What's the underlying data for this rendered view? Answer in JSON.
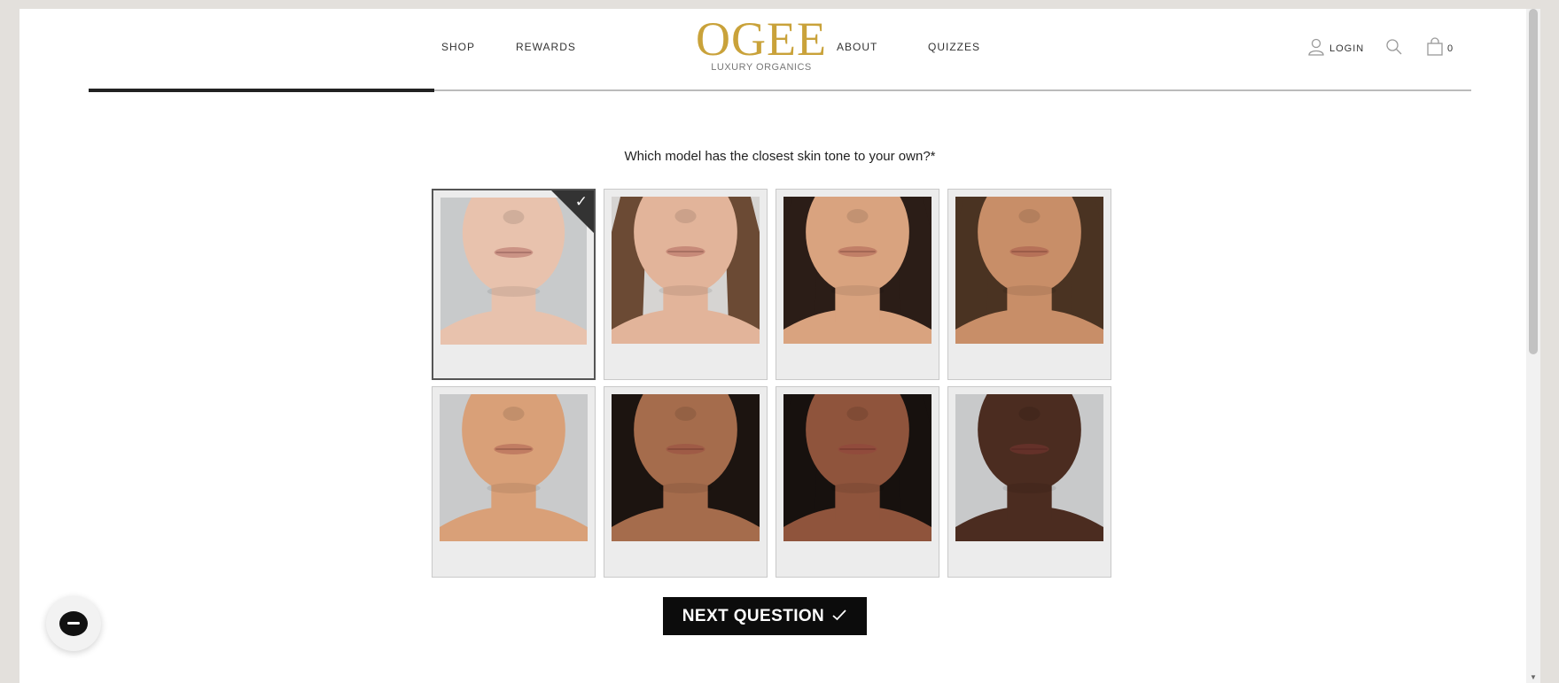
{
  "header": {
    "nav_left": [
      "SHOP",
      "REWARDS"
    ],
    "nav_right": [
      "ABOUT",
      "QUIZZES"
    ],
    "logo_main": "OGEE",
    "logo_sub": "LUXURY ORGANICS",
    "login_label": "LOGIN",
    "cart_count": "0",
    "icons": {
      "user": "user-icon",
      "search": "search-icon",
      "cart": "shopping-bag-icon"
    }
  },
  "progress": {
    "value_percent": 25
  },
  "question": {
    "text": "Which model has the closest skin tone to your own?*",
    "selected_index": 0,
    "options": [
      {
        "skin": "#e8c2ad",
        "bg": "#c8cacb",
        "hair": ""
      },
      {
        "skin": "#e2b49a",
        "bg": "#d6d4d2",
        "hair": "#6b4a34"
      },
      {
        "skin": "#d9a37f",
        "bg": "#2b1d17",
        "hair": "#2b1d17"
      },
      {
        "skin": "#c88e68",
        "bg": "#4a3322",
        "hair": "#4a3322"
      },
      {
        "skin": "#d9a078",
        "bg": "#c9cacb",
        "hair": ""
      },
      {
        "skin": "#a56c4c",
        "bg": "#1c1410",
        "hair": "#1c1410"
      },
      {
        "skin": "#8f543c",
        "bg": "#17110e",
        "hair": "#17110e"
      },
      {
        "skin": "#4b2c20",
        "bg": "#c8c9ca",
        "hair": ""
      }
    ]
  },
  "next_button": {
    "label": "NEXT QUESTION",
    "icon": "check-icon"
  },
  "chat": {
    "icon": "chat-icon"
  },
  "colors": {
    "logo_gold": "#c9a23a",
    "button_bg": "#0c0c0c"
  }
}
